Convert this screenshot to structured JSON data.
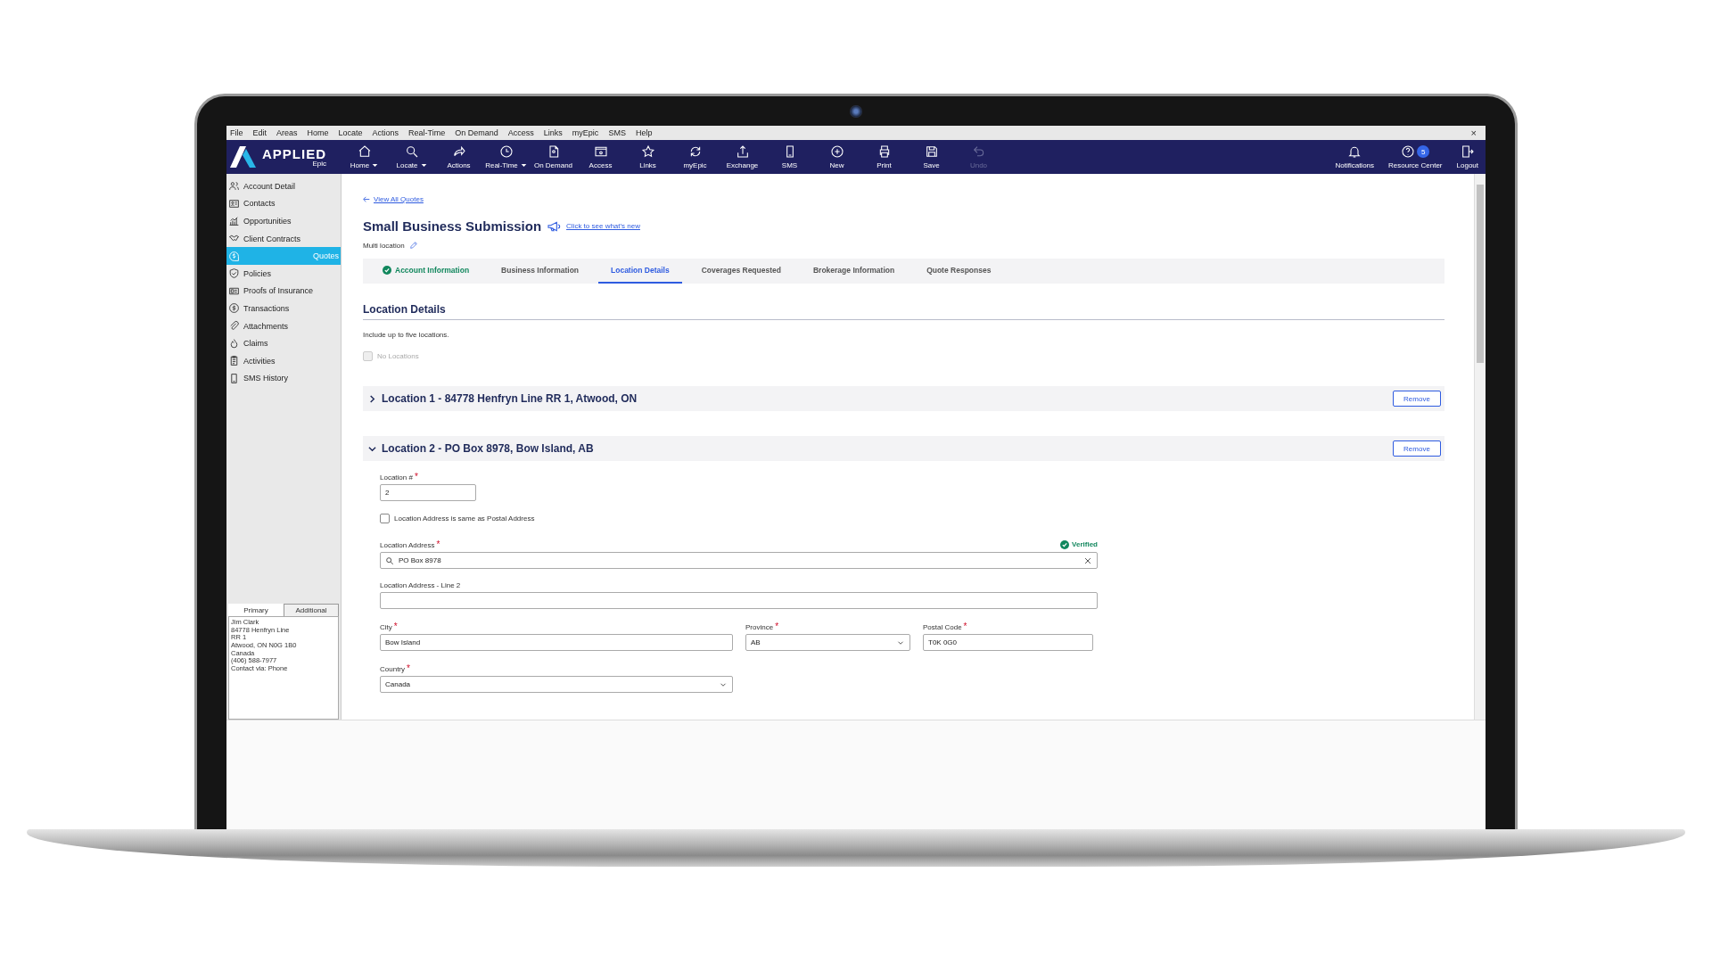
{
  "menu": [
    "File",
    "Edit",
    "Areas",
    "Home",
    "Locate",
    "Actions",
    "Real-Time",
    "On Demand",
    "Access",
    "Links",
    "myEpic",
    "SMS",
    "Help"
  ],
  "window": {
    "close": "×"
  },
  "logo": {
    "name": "APPLIED",
    "sub": "Epic"
  },
  "toolbar": [
    {
      "label": "Home",
      "dropdown": true,
      "disabled": false
    },
    {
      "label": "Locate",
      "dropdown": true,
      "disabled": false
    },
    {
      "label": "Actions",
      "dropdown": false,
      "disabled": false
    },
    {
      "label": "Real-Time",
      "dropdown": true,
      "disabled": false
    },
    {
      "label": "On Demand",
      "dropdown": false,
      "disabled": false
    },
    {
      "label": "Access",
      "dropdown": false,
      "disabled": false
    },
    {
      "label": "Links",
      "dropdown": false,
      "disabled": false
    },
    {
      "label": "myEpic",
      "dropdown": false,
      "disabled": false
    },
    {
      "label": "Exchange",
      "dropdown": false,
      "disabled": false
    },
    {
      "label": "SMS",
      "dropdown": false,
      "disabled": false
    },
    {
      "label": "New",
      "dropdown": false,
      "disabled": false
    },
    {
      "label": "Print",
      "dropdown": false,
      "disabled": false
    },
    {
      "label": "Save",
      "dropdown": false,
      "disabled": false
    },
    {
      "label": "Undo",
      "dropdown": false,
      "disabled": true
    }
  ],
  "toolbar_right": [
    {
      "label": "Notifications"
    },
    {
      "label": "Resource Center",
      "badge": "5"
    },
    {
      "label": "Logout"
    }
  ],
  "sidebar": {
    "items": [
      {
        "label": "Account Detail",
        "selected": false
      },
      {
        "label": "Contacts",
        "selected": false
      },
      {
        "label": "Opportunities",
        "selected": false
      },
      {
        "label": "Client Contracts",
        "selected": false
      },
      {
        "label": "Quotes",
        "selected": true
      },
      {
        "label": "Policies",
        "selected": false
      },
      {
        "label": "Proofs of Insurance",
        "selected": false
      },
      {
        "label": "Transactions",
        "selected": false
      },
      {
        "label": "Attachments",
        "selected": false
      },
      {
        "label": "Claims",
        "selected": false
      },
      {
        "label": "Activities",
        "selected": false
      },
      {
        "label": "SMS History",
        "selected": false
      }
    ],
    "contact_tabs": [
      {
        "label": "Primary",
        "selected": true
      },
      {
        "label": "Additional",
        "selected": false
      }
    ],
    "contact_lines": [
      "Jim Clark",
      "84778 Henfryn Line",
      "RR 1",
      "Atwood, ON  N0G  1B0",
      "Canada",
      "(406) 588-7977",
      "Contact via: Phone"
    ]
  },
  "main": {
    "back_link": "View All Quotes",
    "title": "Small Business Submission",
    "whats_new_link": "Click to see what's new",
    "subtitle": "Multi location",
    "tabs": [
      {
        "label": "Account Information",
        "selected": false,
        "completed": true
      },
      {
        "label": "Business Information",
        "selected": false,
        "completed": false
      },
      {
        "label": "Location Details",
        "selected": true,
        "completed": false
      },
      {
        "label": "Coverages Requested",
        "selected": false,
        "completed": false
      },
      {
        "label": "Brokerage Information",
        "selected": false,
        "completed": false
      },
      {
        "label": "Quote Responses",
        "selected": false,
        "completed": false
      }
    ],
    "section_title": "Location Details",
    "hint": "Include up to five locations.",
    "no_locations": {
      "label": "No Locations",
      "checked": false,
      "disabled": true
    },
    "locations": [
      {
        "title": "Location 1 - 84778 Henfryn Line RR 1, Atwood, ON",
        "expanded": false,
        "remove": "Remove"
      },
      {
        "title": "Location 2 - PO Box 8978, Bow Island, AB",
        "expanded": true,
        "remove": "Remove"
      }
    ],
    "form": {
      "required_mark": "*",
      "location_number": {
        "label": "Location #",
        "required": true,
        "value": "2"
      },
      "same_as_postal": {
        "label": "Location Address is same as Postal Address",
        "checked": false
      },
      "address": {
        "label": "Location Address",
        "required": true,
        "value": "PO Box 8978",
        "status": "Verified"
      },
      "address2": {
        "label": "Location Address - Line 2",
        "required": false
      },
      "city": {
        "label": "City",
        "required": true,
        "value": "Bow Island"
      },
      "province": {
        "label": "Province",
        "required": true,
        "value": "AB"
      },
      "postal_code": {
        "label": "Postal Code",
        "required": true,
        "value": "T0K 0G0"
      },
      "country": {
        "label": "Country",
        "required": true,
        "value": "Canada"
      }
    }
  }
}
